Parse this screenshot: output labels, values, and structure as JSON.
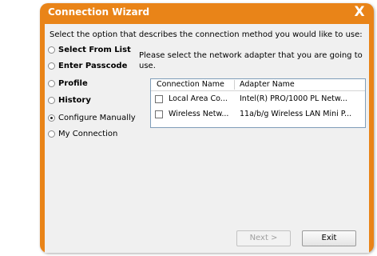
{
  "window": {
    "title": "Connection Wizard",
    "close_glyph": "X",
    "accent_color": "#e98418"
  },
  "prompt": "Select the option that describes the connection method you would like to use:",
  "options": [
    {
      "label": "Select From List",
      "selected": false
    },
    {
      "label": "Enter Passcode",
      "selected": false
    },
    {
      "label": "Profile",
      "selected": false
    },
    {
      "label": "History",
      "selected": false
    },
    {
      "label": "Configure Manually",
      "selected": true
    },
    {
      "label": "My Connection",
      "selected": false
    }
  ],
  "adapter_panel": {
    "instruction": "Please select the network adapter that you are going to use.",
    "columns": [
      "Connection Name",
      "Adapter Name"
    ],
    "rows": [
      {
        "checked": false,
        "connection_name": "Local Area Co...",
        "adapter_name": "Intel(R) PRO/1000 PL Netw..."
      },
      {
        "checked": false,
        "connection_name": "Wireless Netw...",
        "adapter_name": "11a/b/g Wireless LAN Mini P..."
      }
    ]
  },
  "buttons": {
    "next_label": "Next >",
    "next_enabled": false,
    "exit_label": "Exit"
  }
}
